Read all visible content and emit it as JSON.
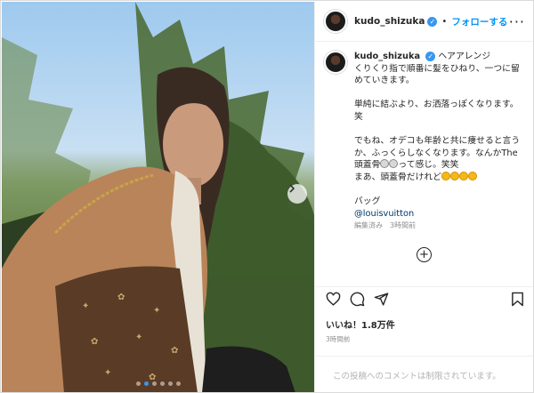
{
  "header": {
    "username": "kudo_shizuka",
    "separator": "•",
    "follow_label": "フォローする",
    "more": "···"
  },
  "caption": {
    "username": "kudo_shizuka",
    "line1": "ヘアアレンジ",
    "line2": "くりくり指で順番に髪をひねり、一つに留めていきます。",
    "line3": "単純に結ぶより、お洒落っぽくなります。笑",
    "line4": "でもね、オデコも年齢と共に痩せると言うか、ふっくらしなくなります。なんかThe 頭蓋骨",
    "line4b": "って感じ。笑笑",
    "line5": "まあ、頭蓋骨だけれど",
    "line6": "バッグ",
    "mention": "@louisvuitton",
    "edited": "編集済み",
    "ago": "3時間前"
  },
  "add_comment_symbol": "+",
  "likes": "いいね！1.8万件",
  "post_time": "3時間前",
  "comment_placeholder": "この投稿へのコメントは制限されています。",
  "carousel": {
    "count": 6,
    "active_index": 1
  },
  "icons": [
    "heart-icon",
    "comment-icon",
    "share-icon",
    "bookmark-icon",
    "chevron-right-icon",
    "verified-icon"
  ],
  "colors": {
    "accent": "#0095f6",
    "mention": "#00376b",
    "muted": "#8e8e8e"
  }
}
